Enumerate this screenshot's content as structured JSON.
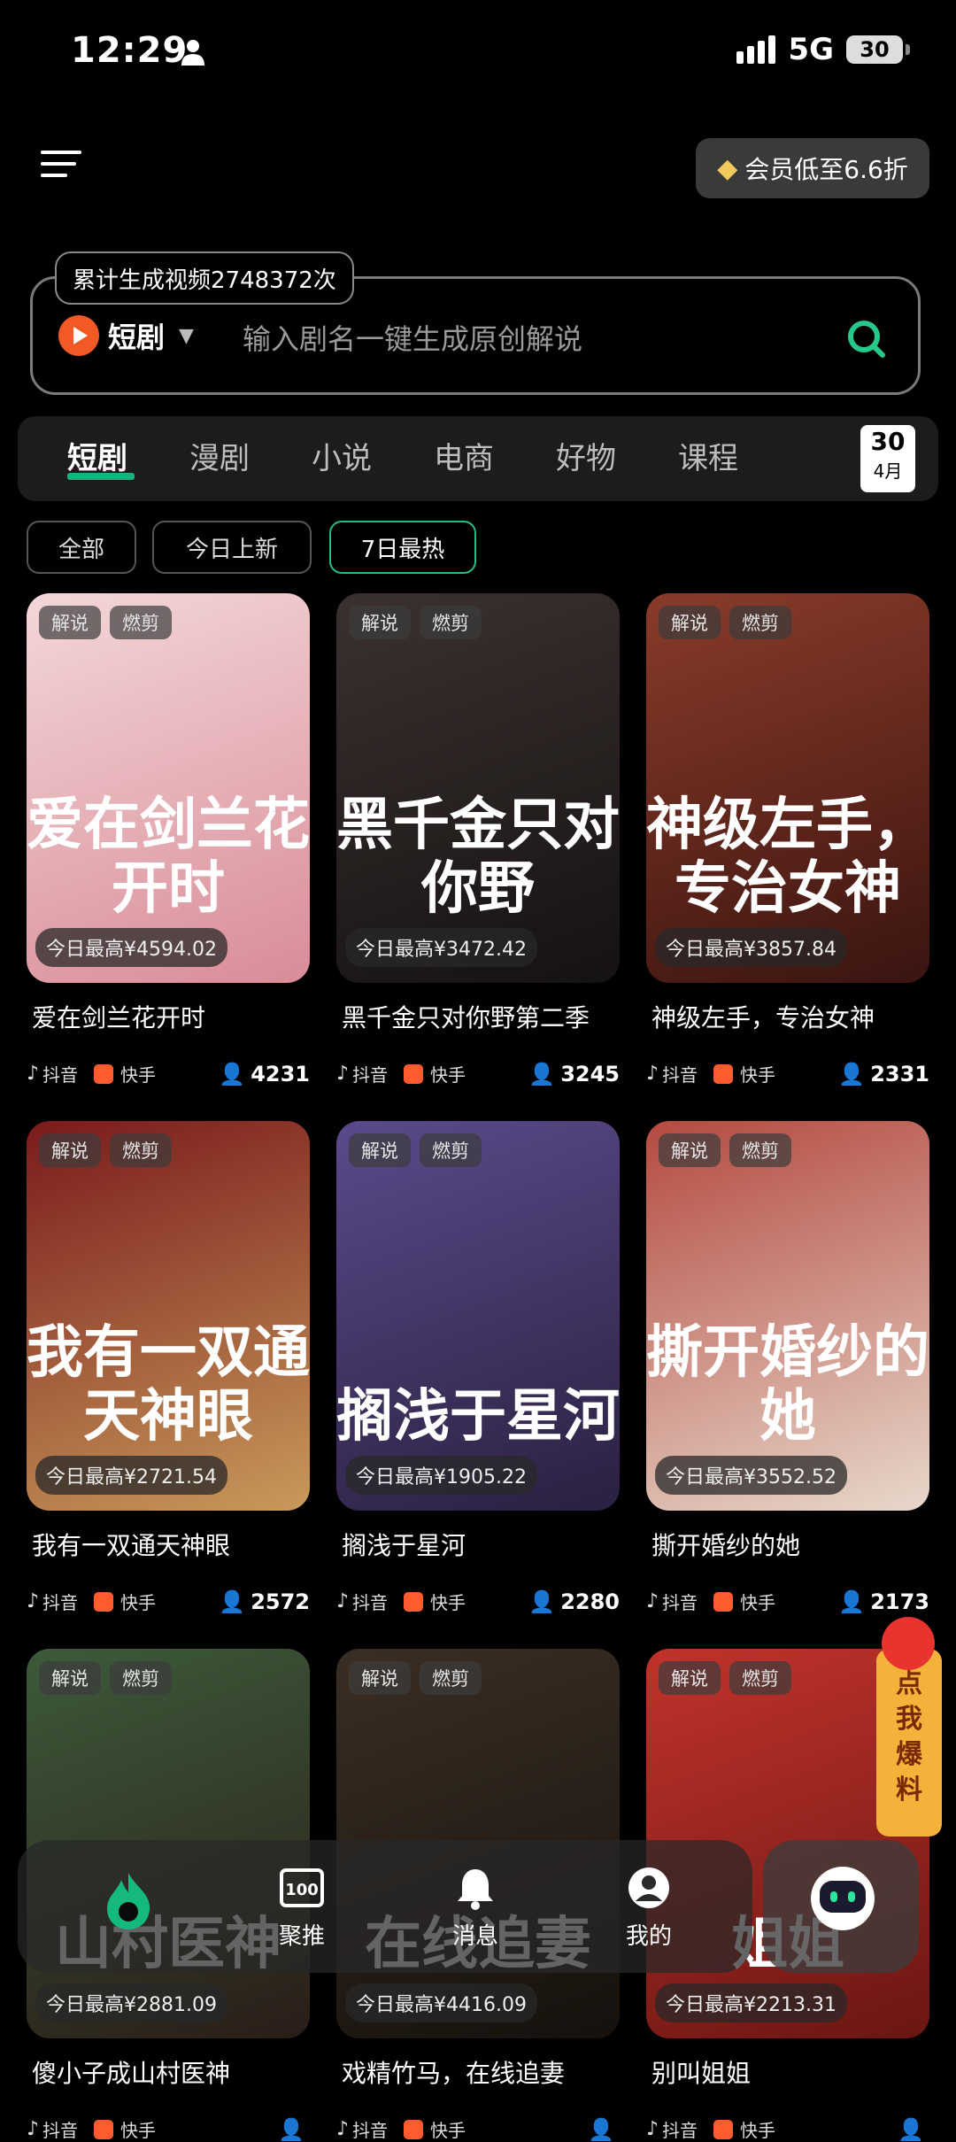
{
  "status_bar": {
    "time": "12:29",
    "network": "5G",
    "battery": "30"
  },
  "header": {
    "vip_label": "会员低至6.6折"
  },
  "search": {
    "counter": "累计生成视频2748372次",
    "category": "短剧",
    "placeholder": "输入剧名一键生成原创解说"
  },
  "tabs": [
    "短剧",
    "漫剧",
    "小说",
    "电商",
    "好物",
    "课程"
  ],
  "calendar": {
    "day": "30",
    "month": "4月"
  },
  "filters": [
    "全部",
    "今日上新",
    "7日最热"
  ],
  "card_tags": [
    "解说",
    "燃剪"
  ],
  "platforms": {
    "douyin": "抖音",
    "kuaishou": "快手"
  },
  "cards": [
    {
      "poster_text": "爱在剑兰花开时",
      "price": "今日最高¥4594.02",
      "title": "爱在剑兰花开时",
      "users": "4231",
      "colors": [
        "#f3d7d9",
        "#d98c97"
      ]
    },
    {
      "poster_text": "黑千金只对你野",
      "price": "今日最高¥3472.42",
      "title": "黑千金只对你野第二季",
      "users": "3245",
      "colors": [
        "#3b3130",
        "#151212"
      ]
    },
    {
      "poster_text": "神级左手，专治女神",
      "price": "今日最高¥3857.84",
      "title": "神级左手，专治女神",
      "users": "2331",
      "colors": [
        "#8a3b2a",
        "#3a1410"
      ]
    },
    {
      "poster_text": "我有一双通天神眼",
      "price": "今日最高¥2721.54",
      "title": "我有一双通天神眼",
      "users": "2572",
      "colors": [
        "#7a1a1c",
        "#c89a5a"
      ]
    },
    {
      "poster_text": "搁浅于星河",
      "price": "今日最高¥1905.22",
      "title": "搁浅于星河",
      "users": "2280",
      "colors": [
        "#5a4a8a",
        "#2a2040"
      ]
    },
    {
      "poster_text": "撕开婚纱的她",
      "price": "今日最高¥3552.52",
      "title": "撕开婚纱的她",
      "users": "2173",
      "colors": [
        "#b44a40",
        "#e8d8cc"
      ]
    },
    {
      "poster_text": "山村医神",
      "price": "今日最高¥2881.09",
      "title": "傻小子成山村医神",
      "users": "",
      "colors": [
        "#3c5a3a",
        "#2a1d18"
      ]
    },
    {
      "poster_text": "在线追妻",
      "price": "今日最高¥4416.09",
      "title": "戏精竹马，在线追妻",
      "users": "",
      "colors": [
        "#3a2e24",
        "#16110d"
      ]
    },
    {
      "poster_text": "姐姐",
      "price": "今日最高¥2213.31",
      "title": "别叫姐姐",
      "users": "",
      "colors": [
        "#c0332b",
        "#6a1612"
      ]
    }
  ],
  "promo": "点我爆料",
  "nav": {
    "push": "聚推",
    "messages": "消息",
    "mine": "我的"
  }
}
